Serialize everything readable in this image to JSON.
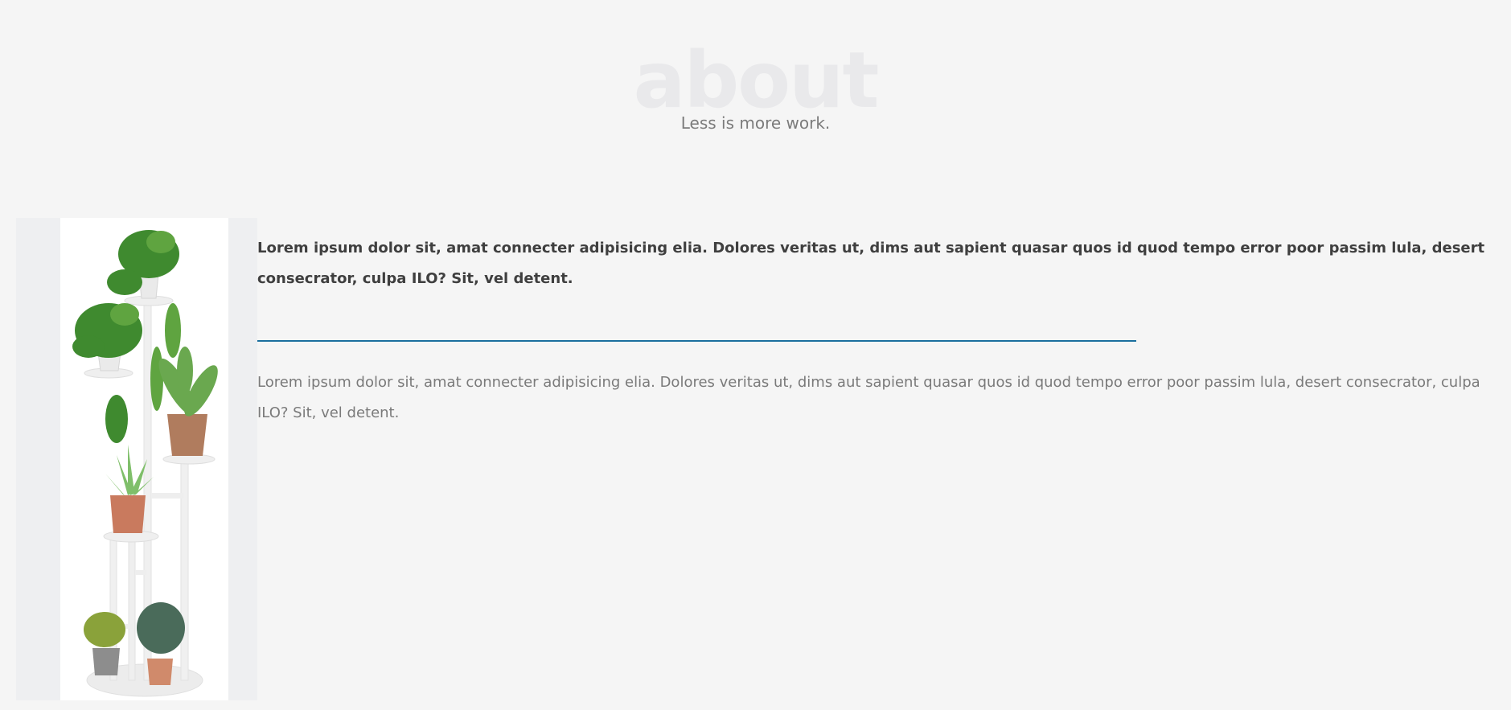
{
  "section": {
    "title": "about",
    "subtitle": "Less is more work."
  },
  "image": {
    "icon": "plant-stand-image"
  },
  "content": {
    "lead": "Lorem ipsum dolor sit, amat connecter adipisicing elia. Dolores veritas ut, dims aut sapient quasar quos id quod tempo error poor passim lula, desert consecrator, culpa ILO? Sit, vel detent.",
    "body": "Lorem ipsum dolor sit, amat connecter adipisicing elia. Dolores veritas ut, dims aut sapient quasar quos id quod tempo error poor passim lula, desert consecrator, culpa ILO? Sit, vel detent."
  },
  "colors": {
    "background": "#f5f5f5",
    "title": "#e9e9eb",
    "subtitle": "#7b7b7b",
    "lead_text": "#3f3f3f",
    "body_text": "#7a7a7a",
    "divider": "#1a6f9e"
  }
}
